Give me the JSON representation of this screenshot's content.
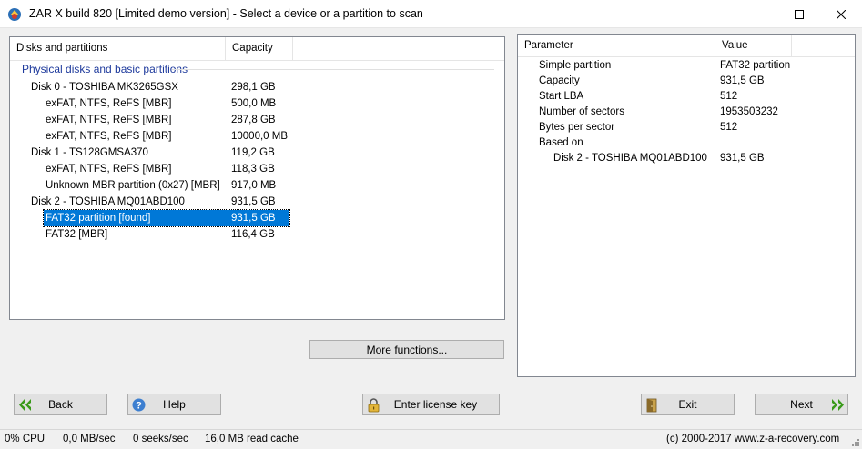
{
  "window": {
    "title": "ZAR X build 820 [Limited demo version] - Select a device or a partition to scan",
    "app_icon": "zar-app-icon"
  },
  "tree": {
    "columns": [
      "Disks and partitions",
      "Capacity"
    ],
    "group_label": "Physical disks and basic partitions",
    "rows": [
      {
        "name": "Disk 0 - TOSHIBA MK3265GSX",
        "capacity": "298,1 GB",
        "level": 0
      },
      {
        "name": "exFAT, NTFS, ReFS [MBR]",
        "capacity": "500,0 MB",
        "level": 1
      },
      {
        "name": "exFAT, NTFS, ReFS [MBR]",
        "capacity": "287,8 GB",
        "level": 1
      },
      {
        "name": "exFAT, NTFS, ReFS [MBR]",
        "capacity": "10000,0 MB",
        "level": 1
      },
      {
        "name": "Disk 1 - TS128GMSA370",
        "capacity": "119,2 GB",
        "level": 0
      },
      {
        "name": "exFAT, NTFS, ReFS [MBR]",
        "capacity": "118,3 GB",
        "level": 1
      },
      {
        "name": "Unknown MBR partition (0x27) [MBR]",
        "capacity": "917,0 MB",
        "level": 1
      },
      {
        "name": "Disk 2 - TOSHIBA MQ01ABD100",
        "capacity": "931,5 GB",
        "level": 0
      },
      {
        "name": "FAT32 partition [found]",
        "capacity": "931,5 GB",
        "level": 1,
        "selected": true
      },
      {
        "name": "FAT32 [MBR]",
        "capacity": "116,4 GB",
        "level": 1
      }
    ]
  },
  "more_functions_label": "More functions...",
  "properties": {
    "columns": [
      "Parameter",
      "Value"
    ],
    "rows": [
      {
        "param": "Simple partition",
        "value": "FAT32 partition",
        "indent": 0
      },
      {
        "param": "Capacity",
        "value": "931,5 GB",
        "indent": 0
      },
      {
        "param": "Start LBA",
        "value": "512",
        "indent": 0
      },
      {
        "param": "Number of sectors",
        "value": "1953503232",
        "indent": 0
      },
      {
        "param": "Bytes per sector",
        "value": "512",
        "indent": 0
      },
      {
        "param": "Based on",
        "value": "",
        "indent": 0
      },
      {
        "param": "Disk 2 - TOSHIBA MQ01ABD100",
        "value": "931,5 GB",
        "indent": 1
      }
    ]
  },
  "buttons": {
    "back": "Back",
    "help": "Help",
    "license": "Enter license key",
    "exit": "Exit",
    "next": "Next"
  },
  "status": {
    "cpu": "0% CPU",
    "speed": "0,0 MB/sec",
    "seeks": "0 seeks/sec",
    "cache": "16,0 MB read cache",
    "copyright": "(c) 2000-2017 www.z-a-recovery.com"
  },
  "colors": {
    "selection": "#0078d7",
    "group_label": "#1e3a9c",
    "arrow_green": "#3a9a1a"
  }
}
